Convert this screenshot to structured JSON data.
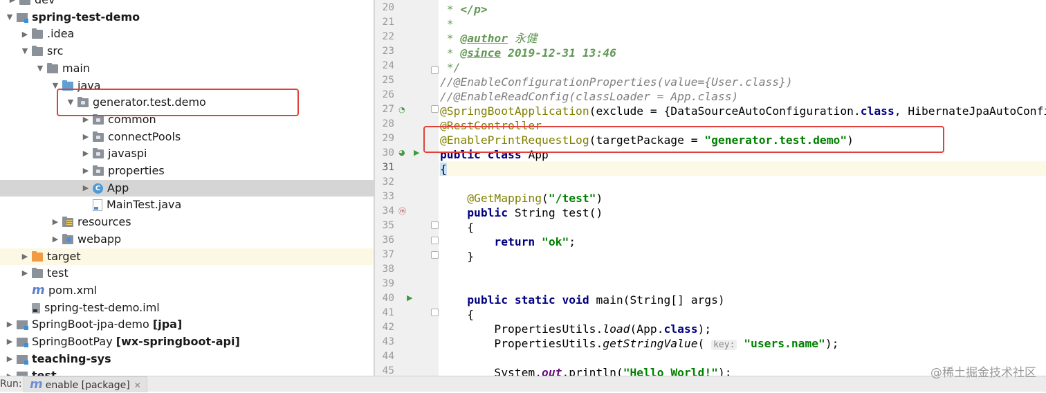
{
  "tree": {
    "rows": [
      {
        "label": "dev",
        "suffix": ""
      },
      {
        "label": "spring-test-demo",
        "suffix": ""
      },
      {
        "label": ".idea",
        "suffix": ""
      },
      {
        "label": "src",
        "suffix": ""
      },
      {
        "label": "main",
        "suffix": ""
      },
      {
        "label": "java",
        "suffix": ""
      },
      {
        "label": "generator.test.demo",
        "suffix": ""
      },
      {
        "label": "common",
        "suffix": ""
      },
      {
        "label": "connectPools",
        "suffix": ""
      },
      {
        "label": "javaspi",
        "suffix": ""
      },
      {
        "label": "properties",
        "suffix": ""
      },
      {
        "label": "App",
        "suffix": ""
      },
      {
        "label": "MainTest.java",
        "suffix": ""
      },
      {
        "label": "resources",
        "suffix": ""
      },
      {
        "label": "webapp",
        "suffix": ""
      },
      {
        "label": "target",
        "suffix": ""
      },
      {
        "label": "test",
        "suffix": ""
      },
      {
        "label": "pom.xml",
        "suffix": ""
      },
      {
        "label": "spring-test-demo.iml",
        "suffix": ""
      },
      {
        "label": "SpringBoot-jpa-demo",
        "suffix": "[jpa]"
      },
      {
        "label": "SpringBootPay",
        "suffix": "[wx-springboot-api]"
      },
      {
        "label": "teaching-sys",
        "suffix": ""
      },
      {
        "label": "test",
        "suffix": ""
      }
    ]
  },
  "editor": {
    "line_numbers": [
      "20",
      "21",
      "22",
      "23",
      "24",
      "25",
      "26",
      "27",
      "28",
      "29",
      "30",
      "31",
      "32",
      "33",
      "34",
      "35",
      "36",
      "37",
      "38",
      "39",
      "40",
      "41",
      "42",
      "43",
      "44",
      "45"
    ],
    "code": {
      "l20a": " * ",
      "l20b": "</p>",
      "l21": " *",
      "l22a": " * ",
      "l22b": "@author",
      "l22c": " 永健",
      "l23a": " * ",
      "l23b": "@since",
      "l23c": " 2019-12-31 13:46",
      "l24": " */",
      "l25": "//@EnableConfigurationProperties(value={User.class})",
      "l26": "//@EnableReadConfig(classLoader = App.class)",
      "l27a": "@SpringBootApplication",
      "l27b": "(exclude = {DataSourceAutoConfiguration.",
      "l27c": "class",
      "l27d": ", HibernateJpaAutoConfiguration.",
      "l28": "@RestController",
      "l29a": "@EnablePrintRequestLog",
      "l29b": "(targetPackage = ",
      "l29c": "\"generator.test.demo\"",
      "l29d": ")",
      "l30a": "public class",
      "l30b": " App",
      "l31": "{",
      "l33a": "    @GetMapping",
      "l33b": "(",
      "l33c": "\"/test\"",
      "l33d": ")",
      "l34a": "    public",
      "l34b": " String test()",
      "l35": "    {",
      "l36a": "        return ",
      "l36b": "\"ok\"",
      "l36c": ";",
      "l37": "    }",
      "l40a": "    public static void",
      "l40b": " main(String[] args)",
      "l41": "    {",
      "l42a": "        PropertiesUtils.",
      "l42b": "load",
      "l42c": "(App.",
      "l42d": "class",
      "l42e": ");",
      "l43a": "        PropertiesUtils.",
      "l43b": "getStringValue",
      "l43c": "( ",
      "l43hint": "key:",
      "l43d": " ",
      "l43e": "\"users.name\"",
      "l43f": ");",
      "l45a": "        System.",
      "l45b": "out",
      "l45c": ".println(",
      "l45d": "\"Hello World!\"",
      "l45e": ");"
    }
  },
  "bottom": {
    "run_label": "Run:",
    "run_tab": "enable [package]",
    "run_tab_icon": "m",
    "close": "✕"
  },
  "watermark": "@稀土掘金技术社区",
  "colors": {
    "highlight_box": "#e0413b",
    "selection": "#d5d5d5",
    "annotation": "#808000",
    "keyword": "#000080",
    "string": "#008000"
  }
}
